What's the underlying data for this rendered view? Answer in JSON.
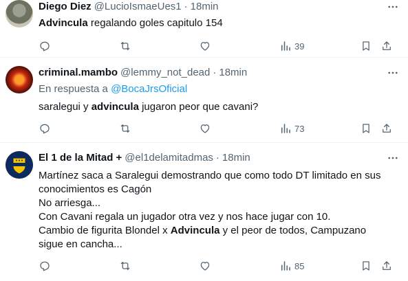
{
  "tweets": [
    {
      "name": "Diego Diez",
      "handle": "@LucioIsmaeUes1",
      "separator": "·",
      "time": "18min",
      "reply_prefix": "",
      "reply_mention": "",
      "lines": [
        [
          {
            "t": "Advincula",
            "b": true
          },
          {
            "t": " regalando goles capitulo 154",
            "b": false
          }
        ]
      ],
      "views": "39"
    },
    {
      "name": "criminal.mambo",
      "handle": "@lemmy_not_dead",
      "separator": "·",
      "time": "18min",
      "reply_prefix": "En respuesta a ",
      "reply_mention": "@BocaJrsOficial",
      "lines": [
        [
          {
            "t": "saralegui y ",
            "b": false
          },
          {
            "t": "advincula",
            "b": true
          },
          {
            "t": " jugaron peor que cavani?",
            "b": false
          }
        ]
      ],
      "views": "73"
    },
    {
      "name": "El 1 de la Mitad +",
      "handle": "@el1delamitadmas",
      "separator": "·",
      "time": "18min",
      "reply_prefix": "",
      "reply_mention": "",
      "lines": [
        [
          {
            "t": "Martínez saca a Saralegui demostrando que como todo DT limitado en sus",
            "b": false
          }
        ],
        [
          {
            "t": "conocimientos es Cagón",
            "b": false
          }
        ],
        [
          {
            "t": "No arriesga...",
            "b": false
          }
        ],
        [
          {
            "t": "Con Cavani regala un jugador otra vez y nos hace jugar con 10.",
            "b": false
          }
        ],
        [
          {
            "t": "Cambio de figurita Blondel x ",
            "b": false
          },
          {
            "t": "Advincula",
            "b": true
          },
          {
            "t": " y el peor de todos, Campuzano",
            "b": false
          }
        ],
        [
          {
            "t": "sigue en cancha...",
            "b": false
          }
        ]
      ],
      "views": "85"
    }
  ],
  "icons": {
    "more": "more-horizontal-icon",
    "reply": "reply-icon",
    "retweet": "retweet-icon",
    "like": "heart-icon",
    "views": "views-chart-icon",
    "bookmark": "bookmark-icon",
    "share": "share-icon"
  },
  "colors": {
    "text": "#0f1419",
    "secondary": "#536471",
    "link": "#1d9bf0",
    "divider": "#eff3f4"
  }
}
